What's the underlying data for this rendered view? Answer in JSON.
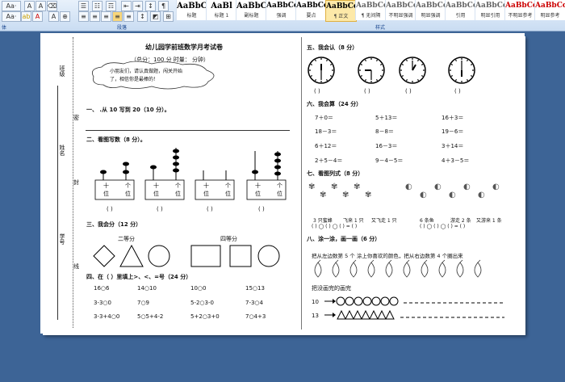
{
  "toolbar": {
    "row1_left": "Aa·",
    "row2_left": "Aa·",
    "group_paragraph": "段落",
    "group_styles": "样式",
    "group_font_tail": "体"
  },
  "styles": [
    {
      "sample": "AaBbC",
      "name": "标题"
    },
    {
      "sample": "AaBl",
      "name": "标题 1"
    },
    {
      "sample": "AaBbC",
      "name": "副标题"
    },
    {
      "sample": "AaBbCcDc",
      "name": "强调"
    },
    {
      "sample": "AaBbCcDt",
      "name": "要点"
    },
    {
      "sample": "AaBbCcDt",
      "name": "¶ 正文"
    },
    {
      "sample": "AaBbCcDt",
      "name": "¶ 无间隔"
    },
    {
      "sample": "AaBbCcDt",
      "name": "不明显强调"
    },
    {
      "sample": "AaBbCcDt",
      "name": "明显强调"
    },
    {
      "sample": "AaBbCcDt",
      "name": "引用"
    },
    {
      "sample": "AaBbCcDt",
      "name": "明显引用"
    },
    {
      "sample": "AaBbCcDt",
      "name": "不明显参考"
    },
    {
      "sample": "AaBbCcDt",
      "name": "明显参考"
    }
  ],
  "sidebar": {
    "class": "班级",
    "name": "姓名",
    "number": "学号",
    "seal": "密",
    "line": "线",
    "edge": "封"
  },
  "title": "幼儿园学前班数学月考试卷",
  "subtitle": "（总分：100 分      时量：      分钟）",
  "cloud": {
    "line1": "小朋友们，请认真做题，闯关开始",
    "line2": "了，相信你是最棒的！"
  },
  "q1": {
    "title": "一、 .从 10 写到 20（10 分）。"
  },
  "q2": {
    "title": "二、看图写数（8 分）。",
    "ten": "十",
    "one": "个",
    "wei": "位",
    "blank": "(    )"
  },
  "q3": {
    "title": "三、我会分（12 分）",
    "left": "二等分",
    "right": "四等分"
  },
  "q4": {
    "title": "四、在（   ）里填上>、<、=号（24 分）",
    "rows": [
      [
        "16○6",
        "14○10",
        "10○0",
        "15○13"
      ],
      [
        "3-3○0",
        "7○9",
        "5-2○3-0",
        "7-3○4"
      ],
      [
        "3-3+4○0",
        "5○5+4-2",
        "5+2○3+0",
        "7○4+3"
      ]
    ]
  },
  "q5": {
    "title": "五、我会认（8 分）",
    "blank": "(    )"
  },
  "q6": {
    "title": "六、我会算（24 分）",
    "rows": [
      [
        "7＋0＝",
        "5＋13＝",
        "16＋3＝"
      ],
      [
        "18－3＝",
        "8－8＝",
        "19－6＝"
      ],
      [
        "6＋12＝",
        "16－3＝",
        "3＋14＝"
      ],
      [
        "2＋5－4＝",
        "9－4－5＝",
        "4＋3－5＝"
      ]
    ]
  },
  "q7": {
    "title": "七、看图列式（8 分）",
    "captions": [
      "3 只蜜蜂",
      "飞来 1 只",
      "又飞走 1 只",
      "6 条鱼",
      "游走 2 条",
      "又游来 1 条"
    ],
    "formula": "(    ) ◯ (    ) ◯ (    ) = (    )"
  },
  "q8": {
    "title": "八、涂一涂，画一画（6 分）",
    "line1": "把从左边数第 5 个     涂上你喜欢的颜色，把从右边数第 4 个圈出来",
    "line2": "把没画完的画完",
    "n1": "10",
    "n2": "13"
  }
}
